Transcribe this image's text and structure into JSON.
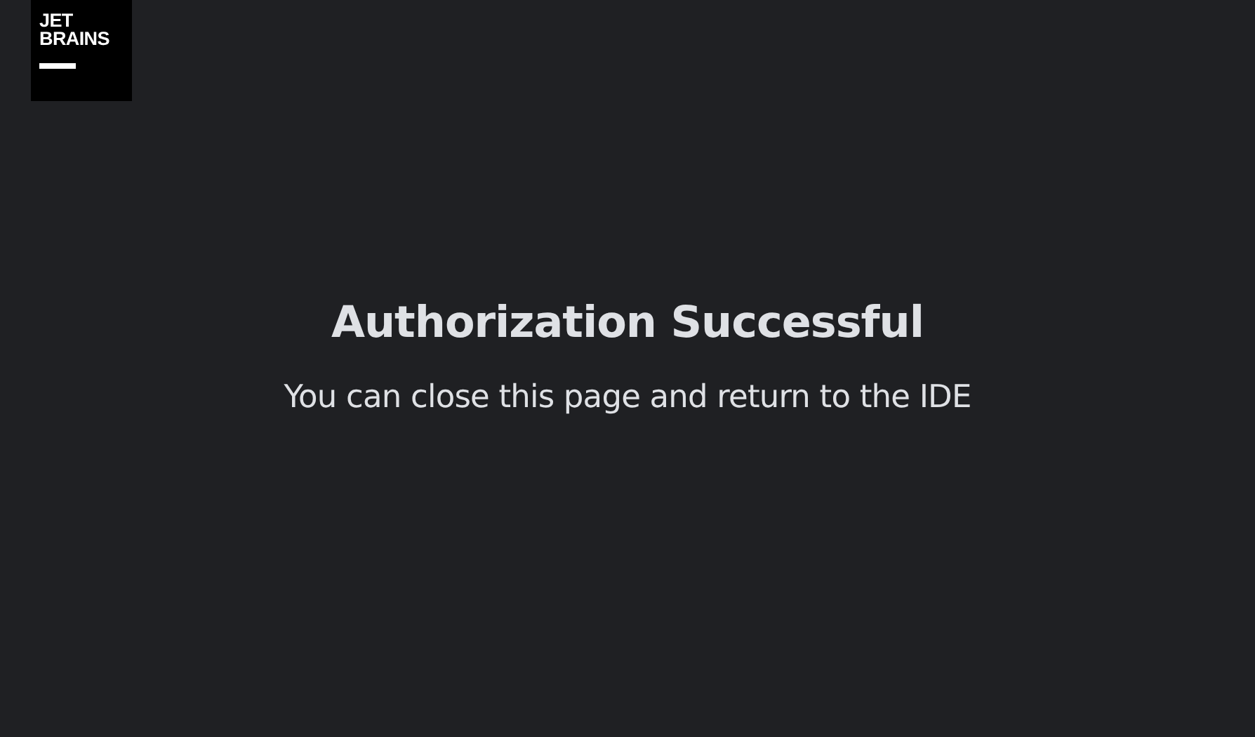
{
  "logo": {
    "lines": [
      "JET",
      "BRAINS"
    ]
  },
  "title": "Authorization Successful",
  "message": "You can close this page and return to the IDE"
}
